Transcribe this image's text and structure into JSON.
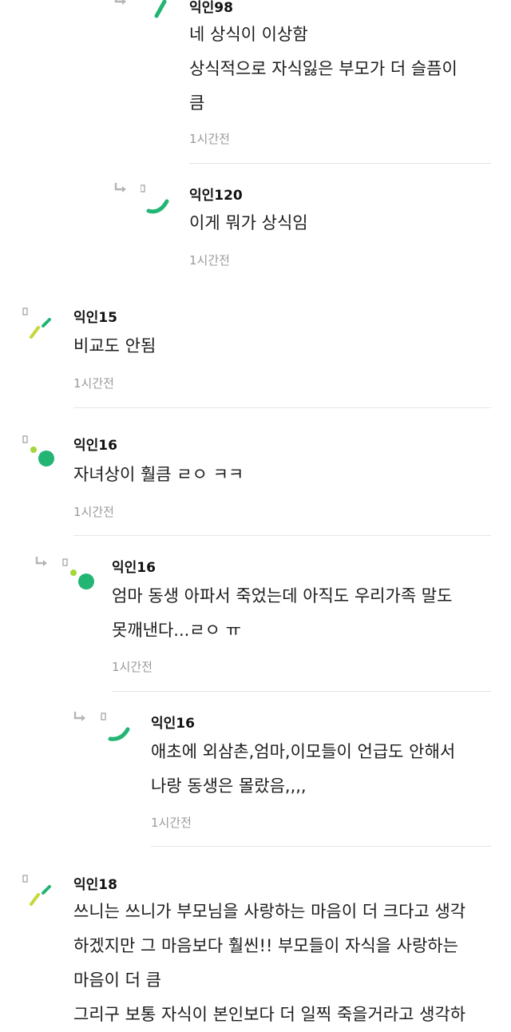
{
  "comments": [
    {
      "author": "익인98",
      "lines": [
        "네 상식이 이상함",
        "상식적으로 자식잃은 부모가 더 슬픔이",
        "큼"
      ],
      "time": "1시간전"
    },
    {
      "author": "익인120",
      "lines": [
        "이게 뭐가 상식임"
      ],
      "time": "1시간전"
    },
    {
      "author": "익인15",
      "lines": [
        "비교도 안됨"
      ],
      "time": "1시간전"
    },
    {
      "author": "익인16",
      "lines": [
        "자녀상이 훨큼 ㄹㅇ ㅋㅋ"
      ],
      "time": "1시간전"
    },
    {
      "author": "익인16",
      "lines": [
        "엄마 동생 아파서 죽었는데 아직도 우리가족 말도",
        "못깨낸다...ㄹㅇ ㅠ"
      ],
      "time": "1시간전"
    },
    {
      "author": "익인16",
      "lines": [
        "애초에 외삼촌,엄마,이모들이 언급도 안해서",
        "나랑 동생은 몰랐음,,,,"
      ],
      "time": "1시간전"
    },
    {
      "author": "익인18",
      "lines": [
        "쓰니는 쓰니가 부모님을 사랑하는 마음이 더 크다고 생각",
        "하겠지만 그 마음보다 훨씬!! 부모들이 자식을 사랑하는",
        "마음이 더 큼",
        "그리구 보통 자식이 본인보다 더 일찍 죽을거라고 생각하"
      ],
      "time": ""
    }
  ],
  "colors": {
    "accent_green": "#22b573",
    "lime": "#a6d63a",
    "yellow_green": "#c6d83a",
    "gray_text": "#9a9a9a"
  },
  "icons": {
    "reply": "reply-arrow-icon",
    "avatar": "anonymous-avatar-icon"
  }
}
